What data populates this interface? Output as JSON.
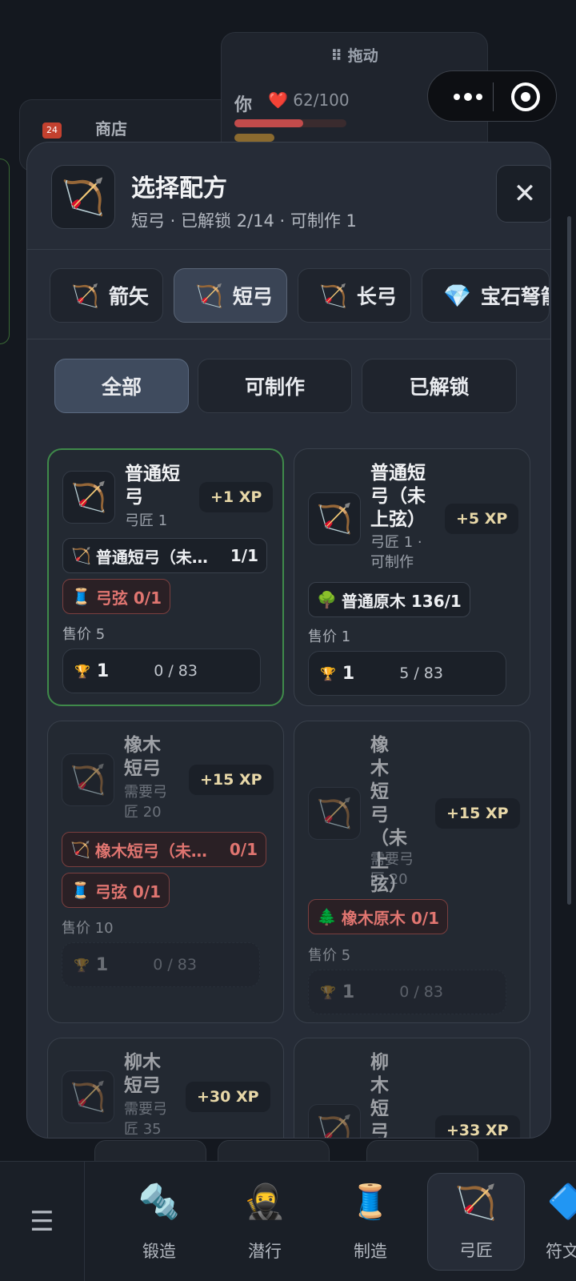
{
  "background": {
    "drag_panel_title": "⠿ 拖动",
    "player_label": "你",
    "player_hp": "❤️ 62/100",
    "shop_icon_text": "24",
    "shop_label": "商店"
  },
  "modal": {
    "icon": "🏹",
    "title": "选择配方",
    "subtitle": "短弓 · 已解锁 2/14 · 可制作 1",
    "close_symbol": "✕",
    "categories": [
      {
        "icon": "🏹",
        "label": "箭矢"
      },
      {
        "icon": "🏹",
        "label": "短弓"
      },
      {
        "icon": "🏹",
        "label": "长弓"
      },
      {
        "icon": "💎",
        "label": "宝石弩箭"
      }
    ],
    "filters": [
      "全部",
      "可制作",
      "已解锁"
    ],
    "recipes": [
      {
        "icon": "🏹",
        "name": "普通短弓",
        "requirement": "弓匠 1",
        "xp": "+1 XP",
        "ingredients": [
          {
            "icon": "🏹",
            "name": "普通短弓（未…",
            "amount": "1/1"
          },
          {
            "icon": "🧵",
            "name": "弓弦 0/1",
            "amount": ""
          }
        ],
        "price": "售价 5",
        "trophy_count": "1",
        "trophy_progress": "0 / 83"
      },
      {
        "icon": "🏹",
        "name": "普通短弓（未上弦）",
        "requirement": "弓匠 1 · 可制作",
        "xp": "+5 XP",
        "ingredients": [
          {
            "icon": "🌳",
            "name": "普通原木 136/1",
            "amount": ""
          }
        ],
        "price": "售价 1",
        "trophy_count": "1",
        "trophy_progress": "5 / 83"
      },
      {
        "icon": "🏹",
        "name": "橡木短弓",
        "requirement": "需要弓匠 20",
        "xp": "+15 XP",
        "ingredients": [
          {
            "icon": "🏹",
            "name": "橡木短弓（未…",
            "amount": "0/1"
          },
          {
            "icon": "🧵",
            "name": "弓弦 0/1",
            "amount": ""
          }
        ],
        "price": "售价 10",
        "trophy_count": "1",
        "trophy_progress": "0 / 83"
      },
      {
        "icon": "🏹",
        "name": "橡木短弓（未上弦）",
        "requirement": "需要弓匠 20",
        "xp": "+15 XP",
        "ingredients": [
          {
            "icon": "🌲",
            "name": "橡木原木 0/1",
            "amount": ""
          }
        ],
        "price": "售价 5",
        "trophy_count": "1",
        "trophy_progress": "0 / 83"
      },
      {
        "icon": "🏹",
        "name": "柳木短弓",
        "requirement": "需要弓匠 35",
        "xp": "+30 XP"
      },
      {
        "icon": "🏹",
        "name": "柳木短弓（未上",
        "xp": "+33 XP"
      }
    ]
  },
  "nav": {
    "menu_symbol": "☰",
    "items": [
      {
        "icon": "🔩",
        "label": "锻造"
      },
      {
        "icon": "🥷",
        "label": "潜行"
      },
      {
        "icon": "🧵",
        "label": "制造"
      },
      {
        "icon": "🏹",
        "label": "弓匠"
      },
      {
        "icon": "🔷",
        "label": "符文"
      }
    ]
  },
  "colors": {
    "accent_selected": "#3f8a4a",
    "missing_ingredient": "#e07570",
    "xp_text": "#e8d8a8"
  }
}
